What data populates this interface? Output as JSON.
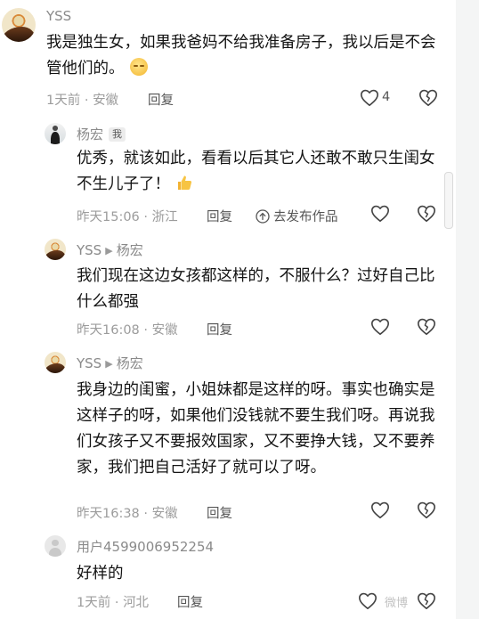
{
  "comments": [
    {
      "user": "YSS",
      "text": "我是独生女，如果我爸妈不给我准备房子，我以后是不会管他们的。",
      "time": "1天前",
      "location": "安徽",
      "reply_label": "回复",
      "like_count": "4",
      "emoji": "thinking-face-emoji"
    },
    {
      "user": "杨宏",
      "badge": "我",
      "text": "优秀，就该如此，看看以后其它人还敢不敢只生闺女不生儿子了！",
      "time": "昨天15:06",
      "location": "浙江",
      "reply_label": "回复",
      "publish_label": "去发布作品",
      "emoji": "thumbs-up-emoji"
    },
    {
      "user": "YSS",
      "reply_to": "杨宏",
      "text": "我们现在这边女孩都这样的，不服什么？过好自己比什么都强",
      "time": "昨天16:08",
      "location": "安徽",
      "reply_label": "回复"
    },
    {
      "user": "YSS",
      "reply_to": "杨宏",
      "text": "我身边的闺蜜，小姐妹都是这样的呀。事实也确实是这样子的呀，如果他们没钱就不要生我们呀。再说我们女孩子又不要报效国家，又不要挣大钱，又不要养家，我们把自己活好了就可以了呀。",
      "time": "昨天16:38",
      "location": "安徽",
      "reply_label": "回复"
    },
    {
      "user": "用户4599006952254",
      "text": "好样的",
      "time": "1天前",
      "location": "河北",
      "reply_label": "回复"
    }
  ],
  "separator": "·",
  "watermark": "微博"
}
